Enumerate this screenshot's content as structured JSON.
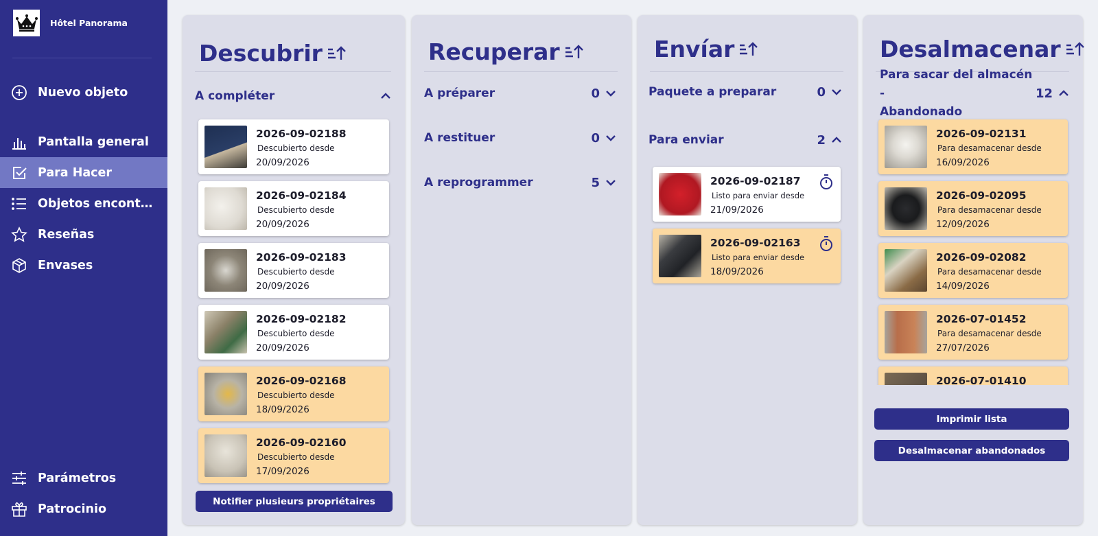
{
  "brand": {
    "name": "Hôtel Panorama",
    "logo_icon": "crown-icon"
  },
  "sidebar": {
    "items": [
      {
        "label": "Nuevo objeto",
        "icon": "plus-circle-icon"
      },
      {
        "label": "Pantalla general",
        "icon": "bar-chart-icon"
      },
      {
        "label": "Para Hacer",
        "icon": "checkbox-icon",
        "active": true
      },
      {
        "label": "Objetos encontrados",
        "icon": "list-icon"
      },
      {
        "label": "Reseñas",
        "icon": "star-icon"
      },
      {
        "label": "Envases",
        "icon": "package-icon"
      },
      {
        "label": "Parámetros",
        "icon": "sliders-icon"
      },
      {
        "label": "Patrocinio",
        "icon": "gift-icon"
      }
    ]
  },
  "columns": {
    "descubrir": {
      "title": "Descubrir",
      "sections": [
        {
          "label": "A compléter",
          "expanded": true
        }
      ],
      "cards": [
        {
          "id": "2026-09-02188",
          "sub": "Descubierto desde",
          "date": "20/09/2026",
          "highlight": false
        },
        {
          "id": "2026-09-02184",
          "sub": "Descubierto desde",
          "date": "20/09/2026",
          "highlight": false
        },
        {
          "id": "2026-09-02183",
          "sub": "Descubierto desde",
          "date": "20/09/2026",
          "highlight": false
        },
        {
          "id": "2026-09-02182",
          "sub": "Descubierto desde",
          "date": "20/09/2026",
          "highlight": false
        },
        {
          "id": "2026-09-02168",
          "sub": "Descubierto desde",
          "date": "18/09/2026",
          "highlight": true
        },
        {
          "id": "2026-09-02160",
          "sub": "Descubierto desde",
          "date": "17/09/2026",
          "highlight": true
        }
      ],
      "button": "Notifier plusieurs propriétaires"
    },
    "recuperar": {
      "title": "Recuperar",
      "sections": [
        {
          "label": "A préparer",
          "count": "0"
        },
        {
          "label": "A restituer",
          "count": "0"
        },
        {
          "label": "A reprogrammer",
          "count": "5"
        }
      ]
    },
    "enviar": {
      "title": "Envíar",
      "sections": [
        {
          "label": "Paquete a preparar",
          "count": "0"
        },
        {
          "label": "Para enviar",
          "count": "2"
        }
      ],
      "cards": [
        {
          "id": "2026-09-02187",
          "sub": "Listo para enviar desde",
          "date": "21/09/2026",
          "highlight": false
        },
        {
          "id": "2026-09-02163",
          "sub": "Listo para enviar desde",
          "date": "18/09/2026",
          "highlight": true
        }
      ]
    },
    "desalmacenar": {
      "title": "Desalmacenar",
      "section": {
        "label_line1": "Para sacar del almacén -",
        "label_line2": "Abandonado",
        "count": "12"
      },
      "cards": [
        {
          "id": "2026-09-02131",
          "sub": "Para desamacenar desde",
          "date": "16/09/2026",
          "highlight": true
        },
        {
          "id": "2026-09-02095",
          "sub": "Para desamacenar desde",
          "date": "12/09/2026",
          "highlight": true
        },
        {
          "id": "2026-09-02082",
          "sub": "Para desamacenar desde",
          "date": "14/09/2026",
          "highlight": true
        },
        {
          "id": "2026-07-01452",
          "sub": "Para desamacenar desde",
          "date": "27/07/2026",
          "highlight": true
        },
        {
          "id": "2026-07-01410",
          "sub": "",
          "date": "",
          "highlight": true
        }
      ],
      "buttons": {
        "print": "Imprimir lista",
        "unstore": "Desalmacenar abandonados"
      }
    }
  },
  "colors": {
    "primary": "#2e2f8a",
    "sidebar_active": "#7278c4",
    "column_bg": "#dcdde9",
    "card_highlight": "#fcd9a1"
  }
}
